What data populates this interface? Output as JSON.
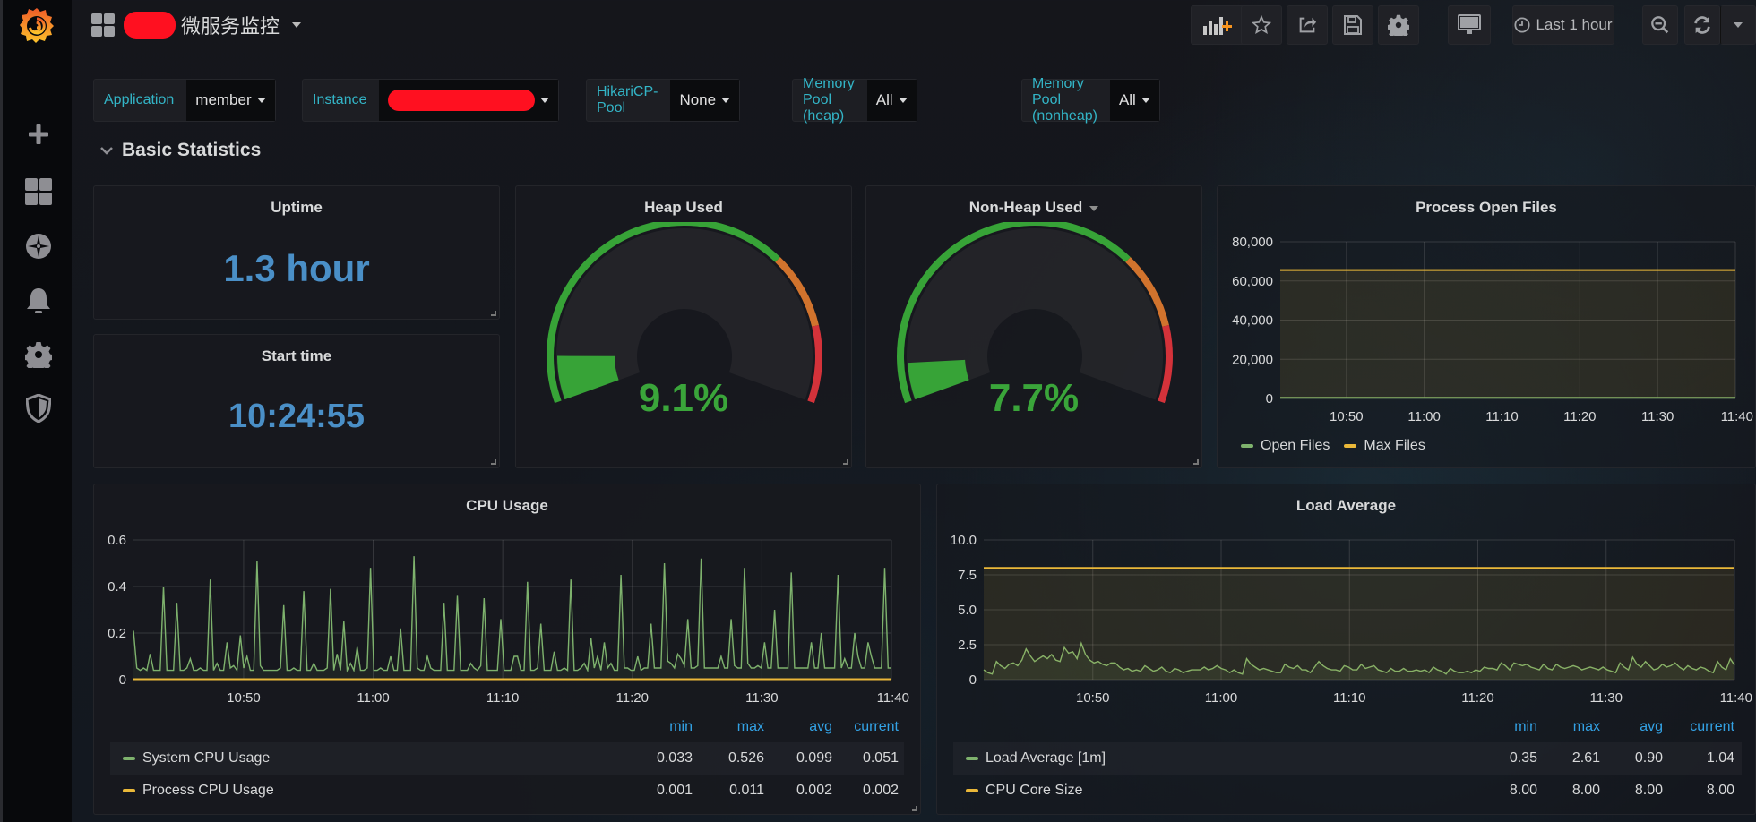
{
  "app": {
    "dashboard_title": "微服务监控",
    "title_redacted": true
  },
  "sidebar": {
    "items": [
      {
        "name": "grafana-logo",
        "label": "Grafana"
      },
      {
        "name": "create",
        "label": "Create"
      },
      {
        "name": "dashboards",
        "label": "Dashboards"
      },
      {
        "name": "explore",
        "label": "Explore"
      },
      {
        "name": "alerting",
        "label": "Alerting"
      },
      {
        "name": "configuration",
        "label": "Configuration"
      },
      {
        "name": "server-admin",
        "label": "Server Admin"
      }
    ]
  },
  "toolbar": {
    "add_panel": "Add panel",
    "star": "Mark as favorite",
    "share": "Share dashboard",
    "save": "Save dashboard",
    "settings": "Dashboard settings",
    "tv_mode": "Cycle view mode",
    "time_range": "Last 1 hour",
    "zoom_out": "Zoom out time range",
    "refresh": "Refresh dashboard"
  },
  "variables": [
    {
      "label": "Application",
      "value": "member"
    },
    {
      "label": "Instance",
      "value": "",
      "redacted": true
    },
    {
      "label": "HikariCP-Pool",
      "value": "None"
    },
    {
      "label": "Memory Pool (heap)",
      "value": "All"
    },
    {
      "label": "Memory Pool (nonheap)",
      "value": "All"
    }
  ],
  "row": {
    "title": "Basic Statistics"
  },
  "panels": {
    "uptime": {
      "title": "Uptime",
      "value": "1.3 hour"
    },
    "start_time": {
      "title": "Start time",
      "value": "10:24:55"
    },
    "heap": {
      "title": "Heap Used",
      "value": "9.1%",
      "percent": 9.1
    },
    "nonheap": {
      "title": "Non-Heap Used",
      "value": "7.7%",
      "percent": 7.7
    },
    "open_files": {
      "title": "Process Open Files"
    },
    "cpu": {
      "title": "CPU Usage"
    },
    "load": {
      "title": "Load Average"
    }
  },
  "colors": {
    "green": "#7eb26d",
    "yellow": "#eab839",
    "gauge_green": "#37a337",
    "gauge_orange": "#d1732d",
    "gauge_red": "#d4323a",
    "stat_blue": "#4a8fc7",
    "label_cyan": "#33b5c7",
    "legend_header": "#33a2e5"
  },
  "chart_data": [
    {
      "id": "open_files",
      "type": "line",
      "title": "Process Open Files",
      "x": [
        "10:50",
        "11:00",
        "11:10",
        "11:20",
        "11:30",
        "11:40"
      ],
      "ylim": [
        0,
        80000
      ],
      "yticks": [
        "0",
        "20,000",
        "40,000",
        "60,000",
        "80,000"
      ],
      "grid": true,
      "legend_position": "bottom-left",
      "series": [
        {
          "name": "Open Files",
          "color": "#7eb26d",
          "constant": 300
        },
        {
          "name": "Max Files",
          "color": "#eab839",
          "constant": 65535
        }
      ]
    },
    {
      "id": "cpu",
      "type": "line",
      "title": "CPU Usage",
      "x": [
        "10:50",
        "11:00",
        "11:10",
        "11:20",
        "11:30",
        "11:40"
      ],
      "ylim": [
        0,
        0.6
      ],
      "yticks": [
        "0",
        "0.2",
        "0.4",
        "0.6"
      ],
      "grid": true,
      "legend_position": "bottom-table",
      "legend_columns": [
        "min",
        "max",
        "avg",
        "current"
      ],
      "series": [
        {
          "name": "System CPU Usage",
          "color": "#7eb26d",
          "min": "0.033",
          "max": "0.526",
          "avg": "0.099",
          "current": "0.051",
          "values": [
            0.21,
            0.05,
            0.04,
            0.05,
            0.04,
            0.11,
            0.04,
            0.04,
            0.04,
            0.4,
            0.04,
            0.04,
            0.04,
            0.33,
            0.04,
            0.04,
            0.05,
            0.09,
            0.04,
            0.04,
            0.05,
            0.04,
            0.04,
            0.43,
            0.04,
            0.07,
            0.04,
            0.04,
            0.16,
            0.05,
            0.06,
            0.04,
            0.19,
            0.05,
            0.1,
            0.04,
            0.04,
            0.51,
            0.06,
            0.04,
            0.04,
            0.04,
            0.04,
            0.04,
            0.05,
            0.32,
            0.04,
            0.04,
            0.05,
            0.04,
            0.04,
            0.38,
            0.04,
            0.04,
            0.07,
            0.04,
            0.04,
            0.04,
            0.05,
            0.39,
            0.04,
            0.11,
            0.04,
            0.25,
            0.04,
            0.07,
            0.04,
            0.14,
            0.04,
            0.04,
            0.05,
            0.48,
            0.04,
            0.04,
            0.05,
            0.04,
            0.04,
            0.1,
            0.04,
            0.04,
            0.22,
            0.04,
            0.04,
            0.04,
            0.53,
            0.05,
            0.04,
            0.04,
            0.1,
            0.05,
            0.04,
            0.04,
            0.04,
            0.33,
            0.04,
            0.04,
            0.04,
            0.36,
            0.04,
            0.04,
            0.04,
            0.07,
            0.05,
            0.04,
            0.06,
            0.35,
            0.04,
            0.04,
            0.04,
            0.04,
            0.26,
            0.04,
            0.04,
            0.04,
            0.1,
            0.1,
            0.04,
            0.04,
            0.42,
            0.04,
            0.04,
            0.05,
            0.24,
            0.04,
            0.04,
            0.04,
            0.12,
            0.04,
            0.04,
            0.05,
            0.04,
            0.43,
            0.04,
            0.04,
            0.05,
            0.07,
            0.04,
            0.18,
            0.05,
            0.1,
            0.04,
            0.16,
            0.05,
            0.07,
            0.04,
            0.04,
            0.45,
            0.05,
            0.05,
            0.04,
            0.04,
            0.1,
            0.04,
            0.05,
            0.05,
            0.24,
            0.05,
            0.05,
            0.05,
            0.5,
            0.08,
            0.07,
            0.05,
            0.11,
            0.09,
            0.06,
            0.26,
            0.05,
            0.05,
            0.06,
            0.52,
            0.05,
            0.05,
            0.05,
            0.05,
            0.05,
            0.1,
            0.05,
            0.05,
            0.26,
            0.06,
            0.05,
            0.05,
            0.48,
            0.07,
            0.05,
            0.05,
            0.06,
            0.05,
            0.16,
            0.05,
            0.05,
            0.3,
            0.05,
            0.05,
            0.05,
            0.05,
            0.46,
            0.05,
            0.05,
            0.05,
            0.05,
            0.05,
            0.16,
            0.05,
            0.05,
            0.2,
            0.05,
            0.05,
            0.05,
            0.05,
            0.45,
            0.05,
            0.09,
            0.05,
            0.05,
            0.2,
            0.1,
            0.05,
            0.05,
            0.16,
            0.1,
            0.05,
            0.05,
            0.05,
            0.48,
            0.05,
            0.05
          ]
        },
        {
          "name": "Process CPU Usage",
          "color": "#eab839",
          "min": "0.001",
          "max": "0.011",
          "avg": "0.002",
          "current": "0.002",
          "constant": 0.002
        }
      ]
    },
    {
      "id": "load",
      "type": "line",
      "title": "Load Average",
      "x": [
        "10:50",
        "11:00",
        "11:10",
        "11:20",
        "11:30",
        "11:40"
      ],
      "ylim": [
        0,
        10
      ],
      "yticks": [
        "0",
        "2.5",
        "5.0",
        "7.5",
        "10.0"
      ],
      "grid": true,
      "legend_position": "bottom-table",
      "legend_columns": [
        "min",
        "max",
        "avg",
        "current"
      ],
      "series": [
        {
          "name": "Load Average [1m]",
          "color": "#7eb26d",
          "min": "0.35",
          "max": "2.61",
          "avg": "0.90",
          "current": "1.04",
          "values": [
            0.7,
            0.5,
            0.4,
            1.3,
            1.0,
            0.8,
            1.1,
            1.2,
            1.0,
            1.4,
            2.2,
            1.7,
            1.3,
            1.5,
            1.7,
            1.5,
            1.8,
            1.4,
            1.3,
            2.3,
            1.9,
            2.0,
            1.5,
            2.6,
            1.8,
            1.4,
            1.2,
            1.3,
            1.1,
            1.0,
            1.2,
            1.2,
            0.9,
            0.7,
            0.8,
            0.6,
            0.7,
            0.6,
            1.0,
            0.8,
            0.6,
            0.7,
            0.9,
            0.6,
            0.5,
            0.8,
            0.7,
            0.5,
            0.6,
            0.7,
            0.7,
            0.7,
            0.9,
            0.7,
            0.8,
            1.0,
            0.8,
            0.7,
            0.5,
            0.7,
            0.5,
            0.4,
            1.5,
            1.1,
            0.9,
            0.7,
            0.8,
            0.7,
            0.6,
            0.5,
            0.5,
            1.1,
            0.9,
            0.8,
            1.0,
            0.7,
            0.7,
            0.5,
            0.9,
            1.3,
            1.0,
            0.8,
            0.7,
            0.7,
            0.6,
            1.0,
            0.9,
            0.7,
            0.7,
            1.1,
            0.8,
            0.9,
            1.0,
            0.7,
            0.6,
            0.5,
            0.8,
            0.6,
            0.6,
            0.8,
            0.6,
            0.6,
            0.7,
            0.6,
            0.7,
            0.5,
            0.9,
            0.7,
            0.6,
            0.4,
            0.8,
            0.6,
            0.5,
            0.5,
            0.6,
            0.5,
            0.7,
            0.6,
            0.9,
            0.8,
            0.8,
            0.7,
            1.2,
            1.0,
            0.7,
            1.2,
            1.1,
            1.0,
            1.1,
            0.9,
            0.8,
            0.7,
            1.1,
            0.8,
            0.7,
            1.1,
            0.9,
            0.8,
            0.9,
            1.0,
            0.9,
            0.7,
            0.8,
            0.9,
            0.8,
            0.7,
            0.9,
            0.7,
            0.6,
            0.5,
            1.2,
            0.9,
            0.7,
            1.6,
            1.1,
            0.9,
            1.3,
            1.0,
            0.7,
            0.8,
            1.1,
            0.9,
            1.0,
            1.2,
            0.9,
            0.7,
            1.0,
            0.8,
            0.7,
            0.9,
            0.8,
            0.6,
            0.5,
            1.3,
            0.9,
            0.7,
            1.5,
            1.04
          ]
        },
        {
          "name": "CPU Core Size",
          "color": "#eab839",
          "min": "8.00",
          "max": "8.00",
          "avg": "8.00",
          "current": "8.00",
          "constant": 8
        }
      ]
    }
  ]
}
